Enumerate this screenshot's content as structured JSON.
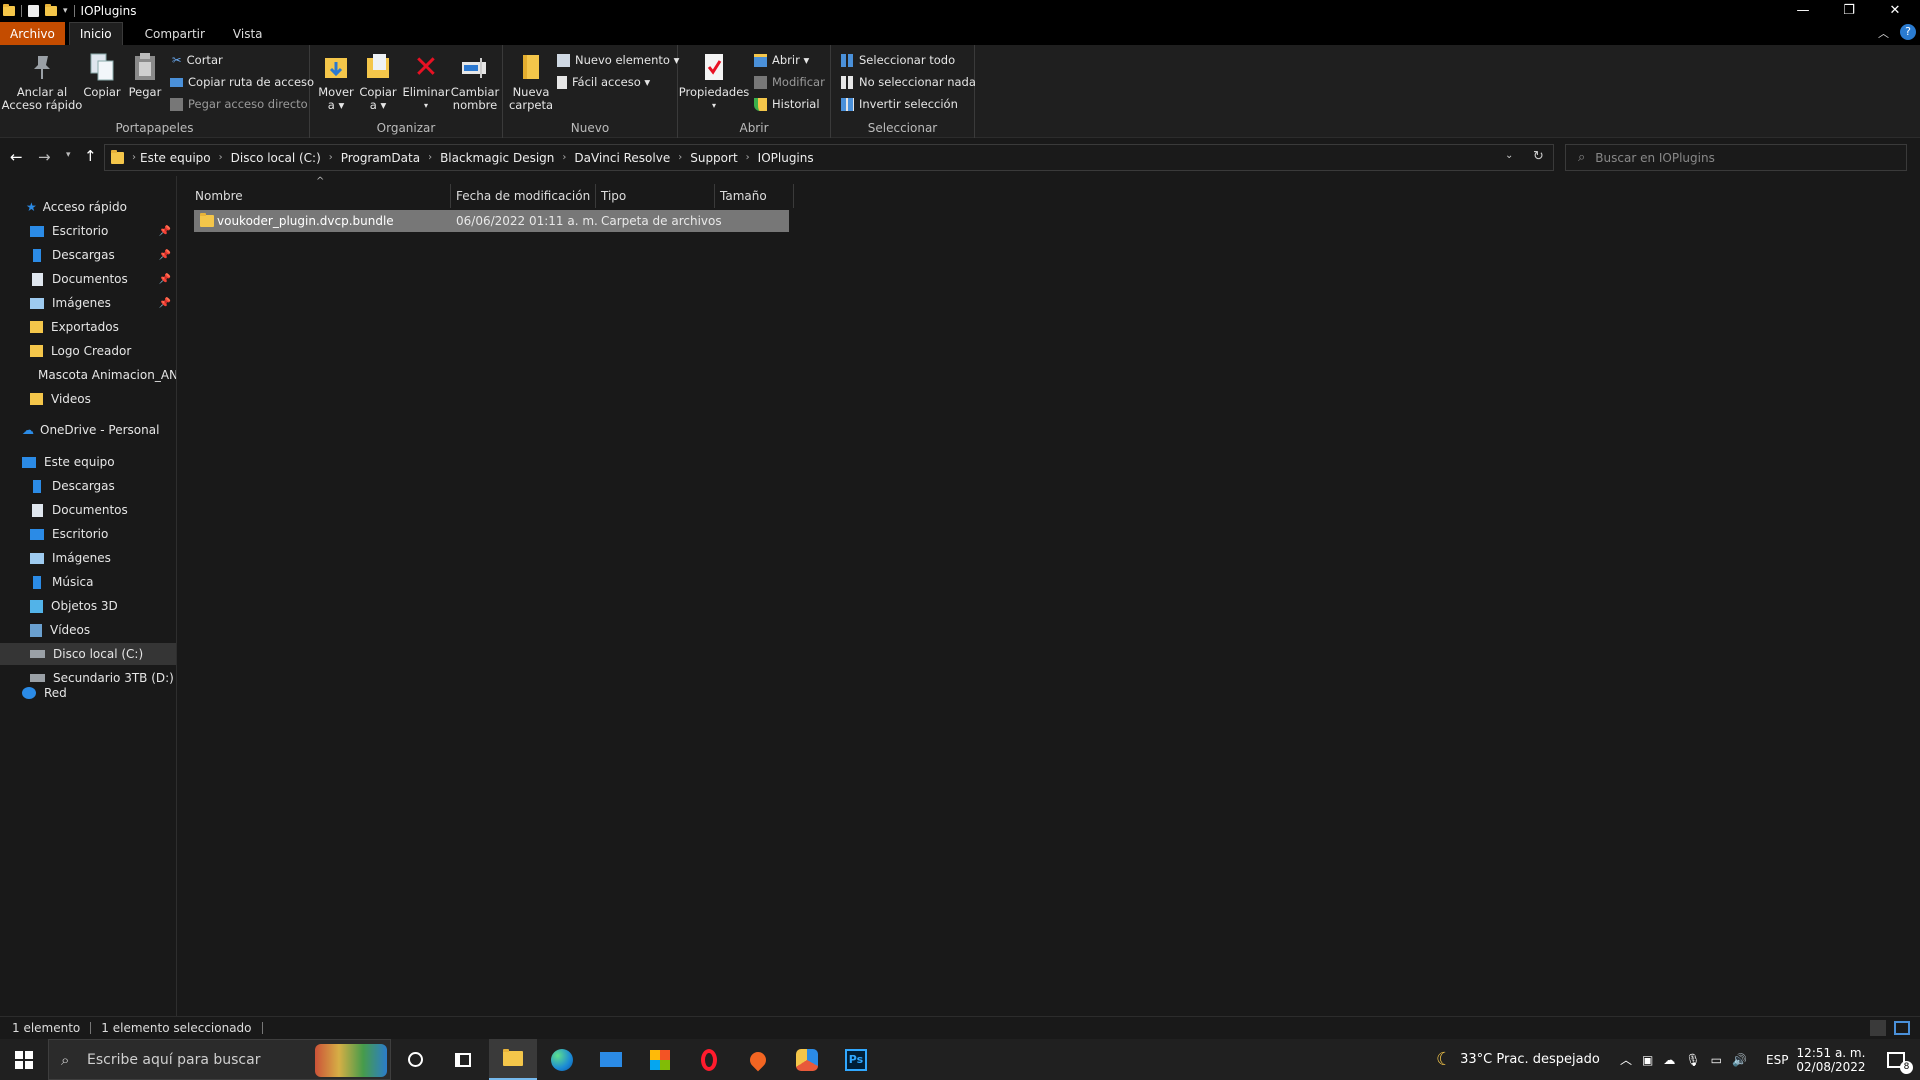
{
  "window": {
    "title": "IOPlugins"
  },
  "tabs": [
    "Archivo",
    "Inicio",
    "Compartir",
    "Vista"
  ],
  "ribbon": {
    "portapapeles": {
      "label": "Portapapeles",
      "anclar": "Anclar al\nAcceso rápido",
      "copiar": "Copiar",
      "pegar": "Pegar",
      "cortar": "Cortar",
      "copiar_ruta": "Copiar ruta de acceso",
      "pegar_acceso": "Pegar acceso directo"
    },
    "organizar": {
      "label": "Organizar",
      "mover": "Mover\na ▾",
      "copiar_a": "Copiar\na ▾",
      "eliminar": "Eliminar",
      "cambiar": "Cambiar\nnombre"
    },
    "nuevo": {
      "label": "Nuevo",
      "carpeta": "Nueva\ncarpeta",
      "nuevo_elemento": "Nuevo elemento ▾",
      "facil_acceso": "Fácil acceso ▾"
    },
    "abrir": {
      "label": "Abrir",
      "propiedades": "Propiedades",
      "abrir": "Abrir ▾",
      "modificar": "Modificar",
      "historial": "Historial"
    },
    "seleccionar": {
      "label": "Seleccionar",
      "todo": "Seleccionar todo",
      "nada": "No seleccionar nada",
      "invertir": "Invertir selección"
    }
  },
  "breadcrumb": [
    "Este equipo",
    "Disco local (C:)",
    "ProgramData",
    "Blackmagic Design",
    "DaVinci Resolve",
    "Support",
    "IOPlugins"
  ],
  "search": {
    "placeholder": "Buscar en IOPlugins"
  },
  "nav": {
    "acceso_rapido": "Acceso rápido",
    "quick": [
      {
        "label": "Escritorio",
        "pinned": true,
        "icon": "desktop-icon"
      },
      {
        "label": "Descargas",
        "pinned": true,
        "icon": "download-icon"
      },
      {
        "label": "Documentos",
        "pinned": true,
        "icon": "document-icon"
      },
      {
        "label": "Imágenes",
        "pinned": true,
        "icon": "image-icon"
      },
      {
        "label": "Exportados",
        "pinned": false,
        "icon": "folder-icon"
      },
      {
        "label": "Logo Creador",
        "pinned": false,
        "icon": "folder-icon"
      },
      {
        "label": "Mascota Animacion_AN",
        "pinned": false,
        "icon": "folder-icon"
      },
      {
        "label": "Videos",
        "pinned": false,
        "icon": "folder-icon"
      }
    ],
    "onedrive": "OneDrive - Personal",
    "este_equipo": "Este equipo",
    "pc": [
      {
        "label": "Descargas",
        "icon": "download-icon"
      },
      {
        "label": "Documentos",
        "icon": "document-icon"
      },
      {
        "label": "Escritorio",
        "icon": "desktop-icon"
      },
      {
        "label": "Imágenes",
        "icon": "image-icon"
      },
      {
        "label": "Música",
        "icon": "music-icon"
      },
      {
        "label": "Objetos 3D",
        "icon": "cube-icon"
      },
      {
        "label": "Vídeos",
        "icon": "video-icon"
      },
      {
        "label": "Disco local (C:)",
        "icon": "drive-icon",
        "selected": true
      },
      {
        "label": "Secundario 3TB (D:)",
        "icon": "drive-icon"
      }
    ],
    "red": "Red"
  },
  "columns": {
    "nombre": "Nombre",
    "fecha": "Fecha de modificación",
    "tipo": "Tipo",
    "tamano": "Tamaño"
  },
  "files": [
    {
      "name": "voukoder_plugin.dvcp.bundle",
      "date": "06/06/2022 01:11 a. m.",
      "type": "Carpeta de archivos",
      "size": ""
    }
  ],
  "status": {
    "count": "1 elemento",
    "selected": "1 elemento seleccionado"
  },
  "taskbar": {
    "search": "Escribe aquí para buscar",
    "weather": "33°C  Prac. despejado",
    "lang": "ESP",
    "time": "12:51 a. m.",
    "date": "02/08/2022",
    "notifications": "8"
  }
}
